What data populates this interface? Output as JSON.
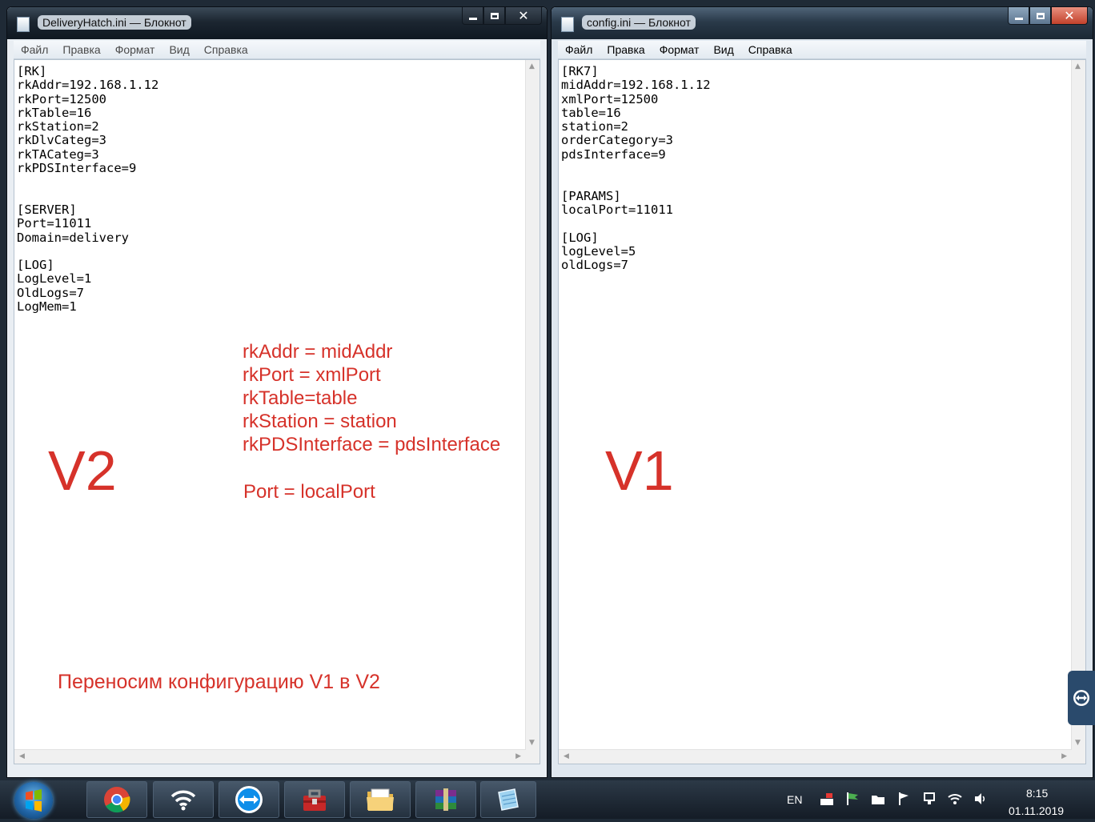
{
  "left_window": {
    "title": "DeliveryHatch.ini — Блокнот",
    "menu": [
      "Файл",
      "Правка",
      "Формат",
      "Вид",
      "Справка"
    ],
    "content": "[RK]\nrkAddr=192.168.1.12\nrkPort=12500\nrkTable=16\nrkStation=2\nrkDlvCateg=3\nrkTACateg=3\nrkPDSInterface=9\n\n\n[SERVER]\nPort=11011\nDomain=delivery\n\n[LOG]\nLogLevel=1\nOldLogs=7\nLogMem=1"
  },
  "right_window": {
    "title": "config.ini — Блокнот",
    "menu": [
      "Файл",
      "Правка",
      "Формат",
      "Вид",
      "Справка"
    ],
    "content": "[RK7]\nmidAddr=192.168.1.12\nxmlPort=12500\ntable=16\nstation=2\norderCategory=3\npdsInterface=9\n\n\n[PARAMS]\nlocalPort=11011\n\n[LOG]\nlogLevel=5\noldLogs=7"
  },
  "annotations": {
    "v2_label": "V2",
    "v1_label": "V1",
    "mappings": [
      "rkAddr = midAddr",
      "rkPort = xmlPort",
      "rkTable=table",
      "rkStation = station",
      "rkPDSInterface = pdsInterface",
      "Port = localPort"
    ],
    "transfer_note": "Переносим конфигурацию V1 в V2",
    "color": "#d6322a"
  },
  "taskbar": {
    "apps": [
      "chrome-icon",
      "wifi-manager-icon",
      "teamviewer-icon",
      "toolbox-icon",
      "file-explorer-icon",
      "winrar-icon",
      "notepad-icon"
    ],
    "language": "EN",
    "time": "8:15",
    "date": "01.11.2019"
  }
}
